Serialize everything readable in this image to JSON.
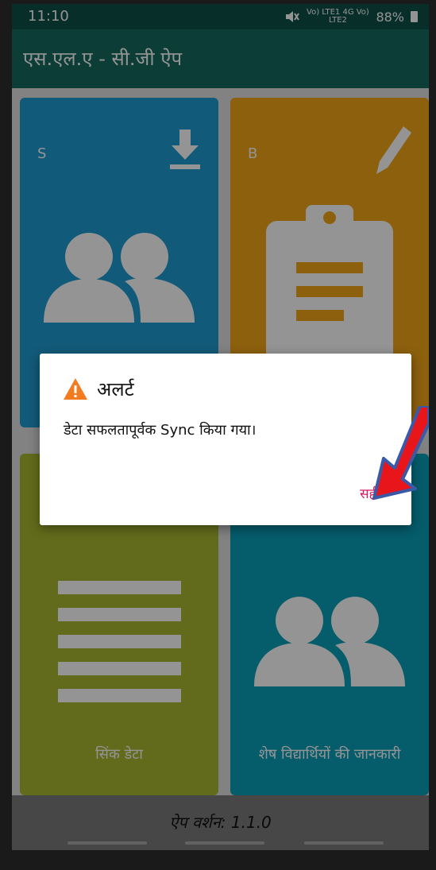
{
  "status_bar": {
    "time": "11:10",
    "signal": "Vo) LTE1 4G Vo) LTE2",
    "battery": "88%"
  },
  "app_bar": {
    "title": "एस.एल.ए - सी.जी ऐप"
  },
  "tiles": [
    {
      "letter": "S",
      "label": ""
    },
    {
      "letter": "B",
      "label": ""
    },
    {
      "letter": "",
      "label": "सिंक डेटा"
    },
    {
      "letter": "",
      "label": "शेष विद्यार्थियों की जानकारी"
    }
  ],
  "footer": {
    "version": "ऐप वर्शन: 1.1.0"
  },
  "dialog": {
    "title": "अलर्ट",
    "message": "डेटा सफलतापूर्वक Sync किया गया।",
    "ok_label": "सही"
  },
  "colors": {
    "status_bar": "#0e5047",
    "app_bar": "#156a5e",
    "tile_blue": "#1f9bd0",
    "tile_orange": "#f2a518",
    "tile_olive": "#a9b82f",
    "tile_teal": "#0a9fb8",
    "dialog_button": "#d81b60",
    "annotation_arrow": "#e8151b"
  },
  "icons": [
    "download-icon",
    "pencil-icon",
    "people-icon",
    "clipboard-icon",
    "list-icon",
    "warning-icon",
    "battery-icon",
    "mute-icon"
  ]
}
